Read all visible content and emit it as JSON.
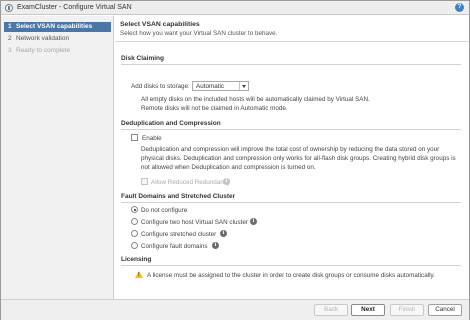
{
  "window": {
    "title": "ExamCluster - Configure Virtual SAN"
  },
  "sidebar": {
    "steps": [
      {
        "num": "1",
        "label": "Select VSAN capabilities",
        "state": "active"
      },
      {
        "num": "2",
        "label": "Network validation",
        "state": "normal"
      },
      {
        "num": "3",
        "label": "Ready to complete",
        "state": "disabled"
      }
    ]
  },
  "main": {
    "title": "Select VSAN capabilities",
    "subtitle": "Select how you want your Virtual SAN cluster to behave.",
    "disk_claiming": {
      "heading": "Disk Claiming",
      "add_disks_label": "Add disks to storage:",
      "add_disks_value": "Automatic",
      "desc_line1": "All empty disks on the included hosts will be automatically claimed by Virtual SAN.",
      "desc_line2": "Remote disks will not be claimed in Automatic mode."
    },
    "dedup": {
      "heading": "Deduplication and Compression",
      "enable_label": "Enable",
      "desc_line1": "Deduplication and compression will improve the total cost of ownership by reducing the data stored on your",
      "desc_line2": "physical disks. Deduplication and compression only works for all-flash disk groups. Creating hybrid disk groups is",
      "desc_line3": "not allowed when Deduplication and compression is turned on.",
      "allow_reduced_label": "Allow Reduced Redundancy"
    },
    "fault_domains": {
      "heading": "Fault Domains and Stretched Cluster",
      "options": [
        {
          "label": "Do not configure",
          "checked": true
        },
        {
          "label": "Configure two host Virtual SAN cluster",
          "checked": false
        },
        {
          "label": "Configure stretched cluster",
          "checked": false
        },
        {
          "label": "Configure fault domains",
          "checked": false
        }
      ]
    },
    "licensing": {
      "heading": "Licensing",
      "warning": "A license must be assigned to the cluster in order to create disk groups or consume disks automatically."
    }
  },
  "footer": {
    "back": "Back",
    "next": "Next",
    "finish": "Finish",
    "cancel": "Cancel"
  },
  "colors": {
    "active_step": "#4a76a8",
    "warning": "#f2bd1d",
    "info": "#6b6b6b"
  }
}
